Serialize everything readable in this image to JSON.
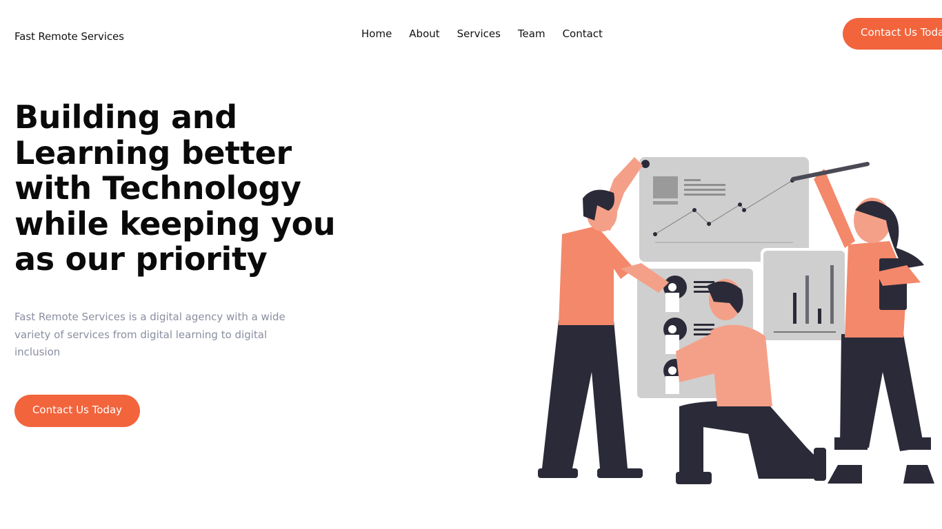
{
  "header": {
    "brand": "Fast Remote Services",
    "nav": [
      {
        "label": "Home"
      },
      {
        "label": "About"
      },
      {
        "label": "Services"
      },
      {
        "label": "Team"
      },
      {
        "label": "Contact"
      }
    ],
    "cta_label": "Contact Us Today"
  },
  "hero": {
    "title": "Building and Learning better with Technology while keeping you as our priority",
    "description": "Fast Remote Services is a digital agency with a wide variety of services from digital learning to digital inclusion",
    "cta_label": "Contact Us Today"
  },
  "illustration": {
    "icon": "team-collaboration-illustration"
  },
  "colors": {
    "accent": "#f2643c",
    "skin": "#f4a088",
    "shirt": "#f4886a",
    "pants": "#2b2a38",
    "panel": "#cfcfcf",
    "muted_text": "#8a8ea0"
  }
}
